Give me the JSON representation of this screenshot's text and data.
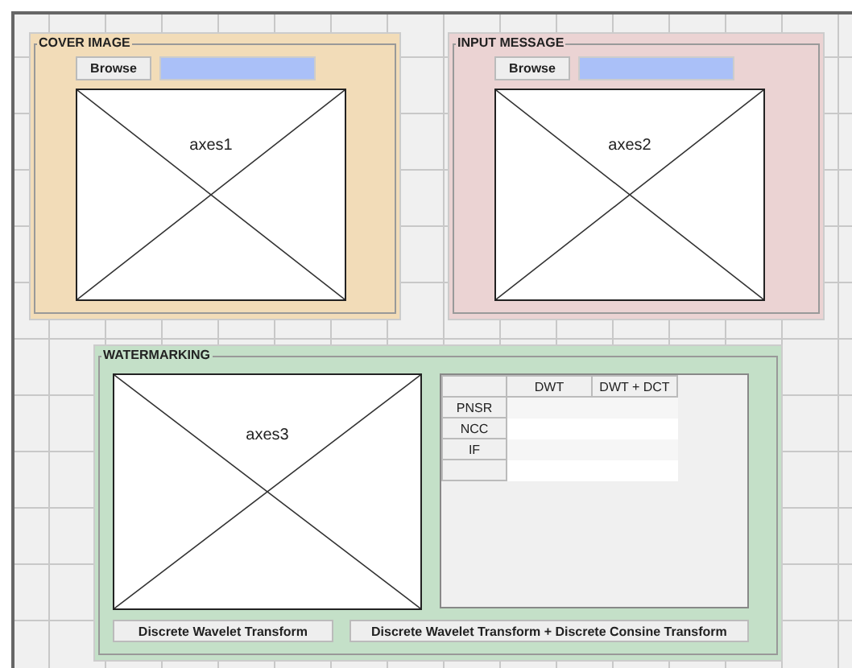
{
  "panels": [
    {
      "kind": "input",
      "title": "COVER IMAGE",
      "color": "#f2dcb8",
      "browse_button": "Browse",
      "axes": "axes1"
    },
    {
      "kind": "input",
      "title": "INPUT MESSAGE",
      "color": "#ebd3d3",
      "browse_button": "Browse",
      "axes": "axes2"
    },
    {
      "kind": "results",
      "title": "WATERMARKING",
      "color": "#c4e0c8",
      "axes": "axes3",
      "table": {
        "columns": [
          "DWT",
          "DWT + DCT"
        ],
        "rows": [
          {
            "label": "PNSR"
          },
          {
            "label": "NCC"
          },
          {
            "label": "IF"
          },
          {}
        ]
      },
      "buttons": [
        "Discrete Wavelet Transform",
        "Discrete Wavelet Transform + Discrete Consine Transform"
      ]
    }
  ]
}
